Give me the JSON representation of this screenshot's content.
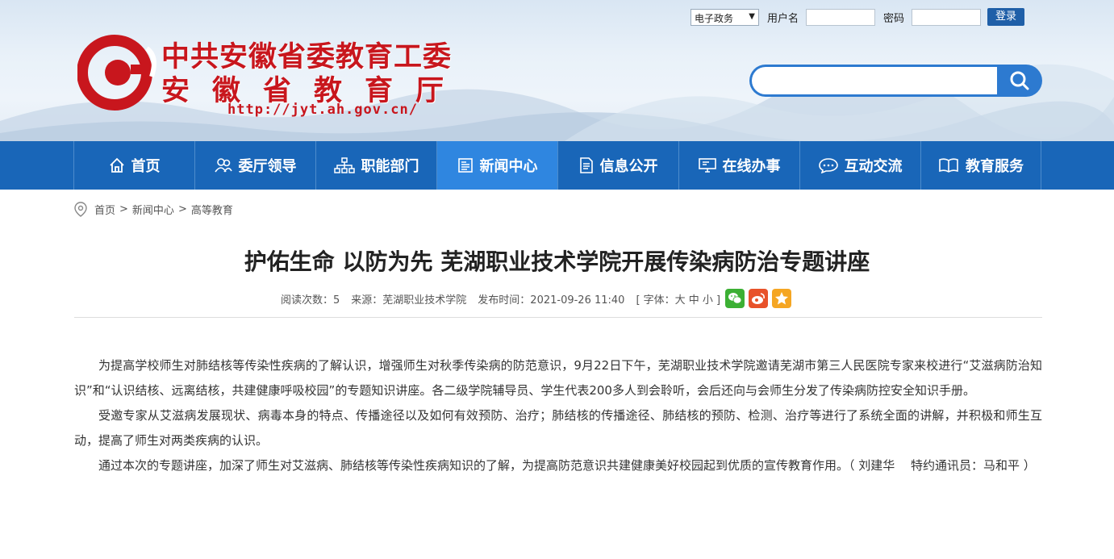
{
  "login": {
    "select_value": "电子政务",
    "username_label": "用户名",
    "password_label": "密码",
    "login_button": "登录"
  },
  "logo": {
    "line1": "中共安徽省委教育工委",
    "line2": "安徽省教育厅",
    "url": "http://jyt.ah.gov.cn/"
  },
  "search": {
    "placeholder": ""
  },
  "nav": {
    "items": [
      {
        "label": "首页",
        "icon": "home-icon"
      },
      {
        "label": "委厅领导",
        "icon": "people-icon"
      },
      {
        "label": "职能部门",
        "icon": "org-chart-icon"
      },
      {
        "label": "新闻中心",
        "icon": "news-icon"
      },
      {
        "label": "信息公开",
        "icon": "document-icon"
      },
      {
        "label": "在线办事",
        "icon": "monitor-icon"
      },
      {
        "label": "互动交流",
        "icon": "chat-icon"
      },
      {
        "label": "教育服务",
        "icon": "book-icon"
      }
    ],
    "active_index": 3
  },
  "breadcrumb": [
    "首页",
    "新闻中心",
    "高等教育"
  ],
  "article": {
    "title": "护佑生命 以防为先 芜湖职业技术学院开展传染病防治专题讲座",
    "reads": "阅读次数：5",
    "source": "来源：芜湖职业技术学院",
    "published": "发布时间：2021-09-26 11:40",
    "font_size": "[ 字体：大 中 小 ]",
    "paragraphs": [
      "为提高学校师生对肺结核等传染性疾病的了解认识，增强师生对秋季传染病的防范意识，9月22日下午，芜湖职业技术学院邀请芜湖市第三人民医院专家来校进行“艾滋病防治知识”和“认识结核、远离结核，共建健康呼吸校园”的专题知识讲座。各二级学院辅导员、学生代表200多人到会聆听，会后还向与会师生分发了传染病防控安全知识手册。",
      "受邀专家从艾滋病发展现状、病毒本身的特点、传播途径以及如何有效预防、治疗；肺结核的传播途径、肺结核的预防、检测、治疗等进行了系统全面的讲解，并积极和师生互动，提高了师生对两类疾病的认识。",
      "通过本次的专题讲座，加深了师生对艾滋病、肺结核等传染性疾病知识的了解，为提高防范意识共建健康美好校园起到优质的宣传教育作用。（ 刘建华　 特约通讯员：马和平 ）"
    ]
  },
  "colors": {
    "nav_bg": "#1966b8",
    "nav_active": "#2f86e0",
    "logo_red": "#c8161d",
    "search_blue": "#2d7ad0"
  }
}
